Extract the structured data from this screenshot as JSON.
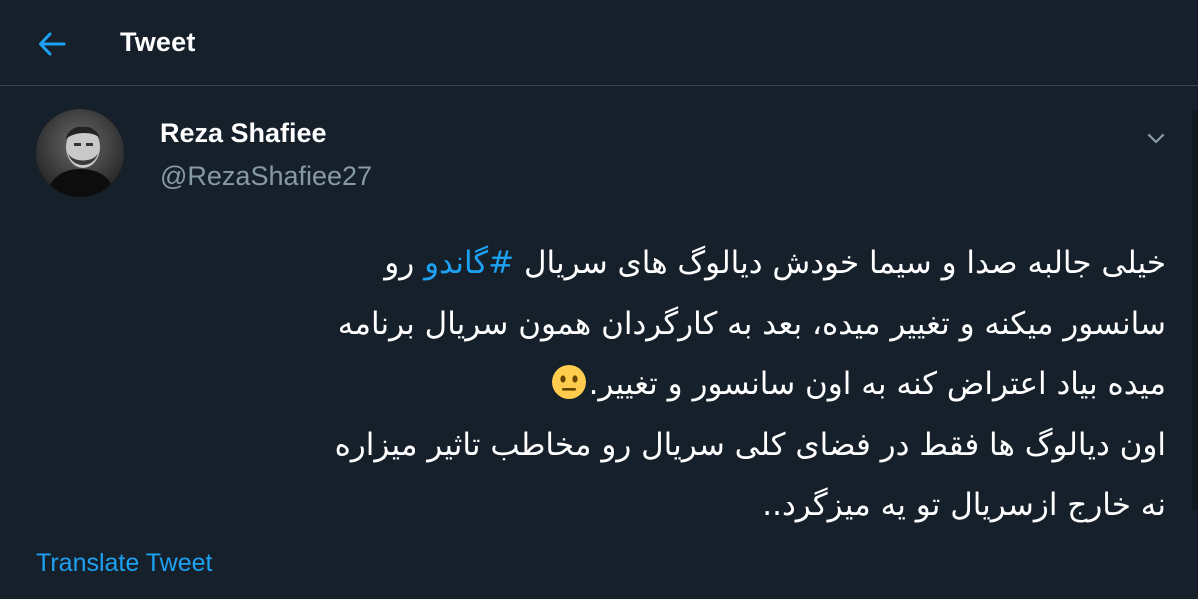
{
  "header": {
    "title": "Tweet",
    "back_icon": "arrow-left-icon",
    "accent_color": "#1da1f2"
  },
  "tweet": {
    "author": {
      "display_name": "Reza Shafiee",
      "handle": "@RezaShafiee27",
      "avatar_icon": "profile-photo"
    },
    "menu_icon": "chevron-down-icon",
    "text_lines": {
      "l1_before": "خیلی جالبه صدا و سیما خودش دیالوگ های سریال ",
      "l1_hashtag": "#گاندو",
      "l1_after": " رو",
      "l2": "سانسور میکنه و تغییر میده، بعد به کارگردان همون سریال برنامه",
      "l3": "میده بیاد اعتراض کنه به اون سانسور و تغییر.",
      "l3_emoji": "neutral-face-emoji",
      "l4": "اون دیالوگ ها فقط در فضای کلی سریال رو مخاطب تاثیر میزاره",
      "l5": "نه خارج ازسریال تو یه میزگرد.."
    },
    "translate_label": "Translate Tweet"
  },
  "colors": {
    "background": "#15202b",
    "secondary_text": "#8899a6",
    "divider": "#38444d",
    "link": "#1da1f2"
  }
}
